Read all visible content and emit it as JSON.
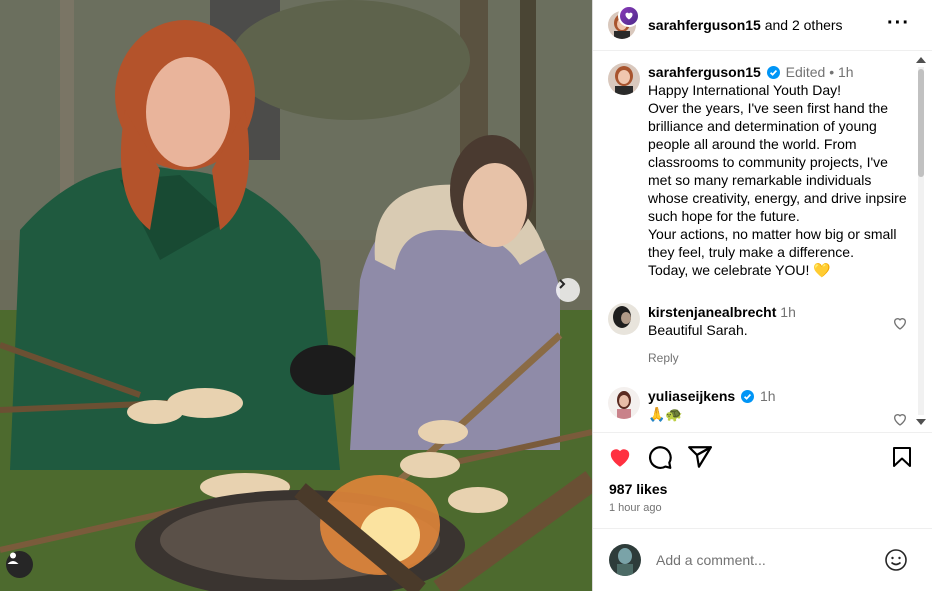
{
  "photo": {
    "description_icon": "next-arrow-icon",
    "tag_icon": "user-tag-icon"
  },
  "header": {
    "username": "sarahferguson15",
    "coauthors": "and 2 others",
    "more_icon": "more-icon"
  },
  "caption": {
    "username": "sarahferguson15",
    "edited": "Edited",
    "separator": "•",
    "time": "1h",
    "text": "Happy International Youth Day!\nOver the years, I've seen first hand the brilliance and determination of young people all around the world. From classrooms to community projects, I've met so many remarkable individuals whose creativity, energy, and drive inpsire such hope for the future.\nYour actions, no matter how big or small they feel, truly make a difference.\nToday, we celebrate YOU! 💛"
  },
  "comments": [
    {
      "username": "kirstenjanealbrecht",
      "time": "1h",
      "text": "Beautiful Sarah.",
      "reply": "Reply"
    },
    {
      "username": "yuliaseijkens",
      "time": "1h",
      "text": "🙏🐢",
      "verified": true
    }
  ],
  "actions": {
    "like_icon": "heart-filled-icon",
    "comment_icon": "comment-icon",
    "share_icon": "share-icon",
    "save_icon": "bookmark-icon",
    "like_color": "#ff3040"
  },
  "likes": "987 likes",
  "posted": "1 hour ago",
  "add_comment": {
    "placeholder": "Add a comment...",
    "emoji_icon": "emoji-icon"
  },
  "colors": {
    "verified": "#0095f6",
    "muted": "#737373"
  }
}
